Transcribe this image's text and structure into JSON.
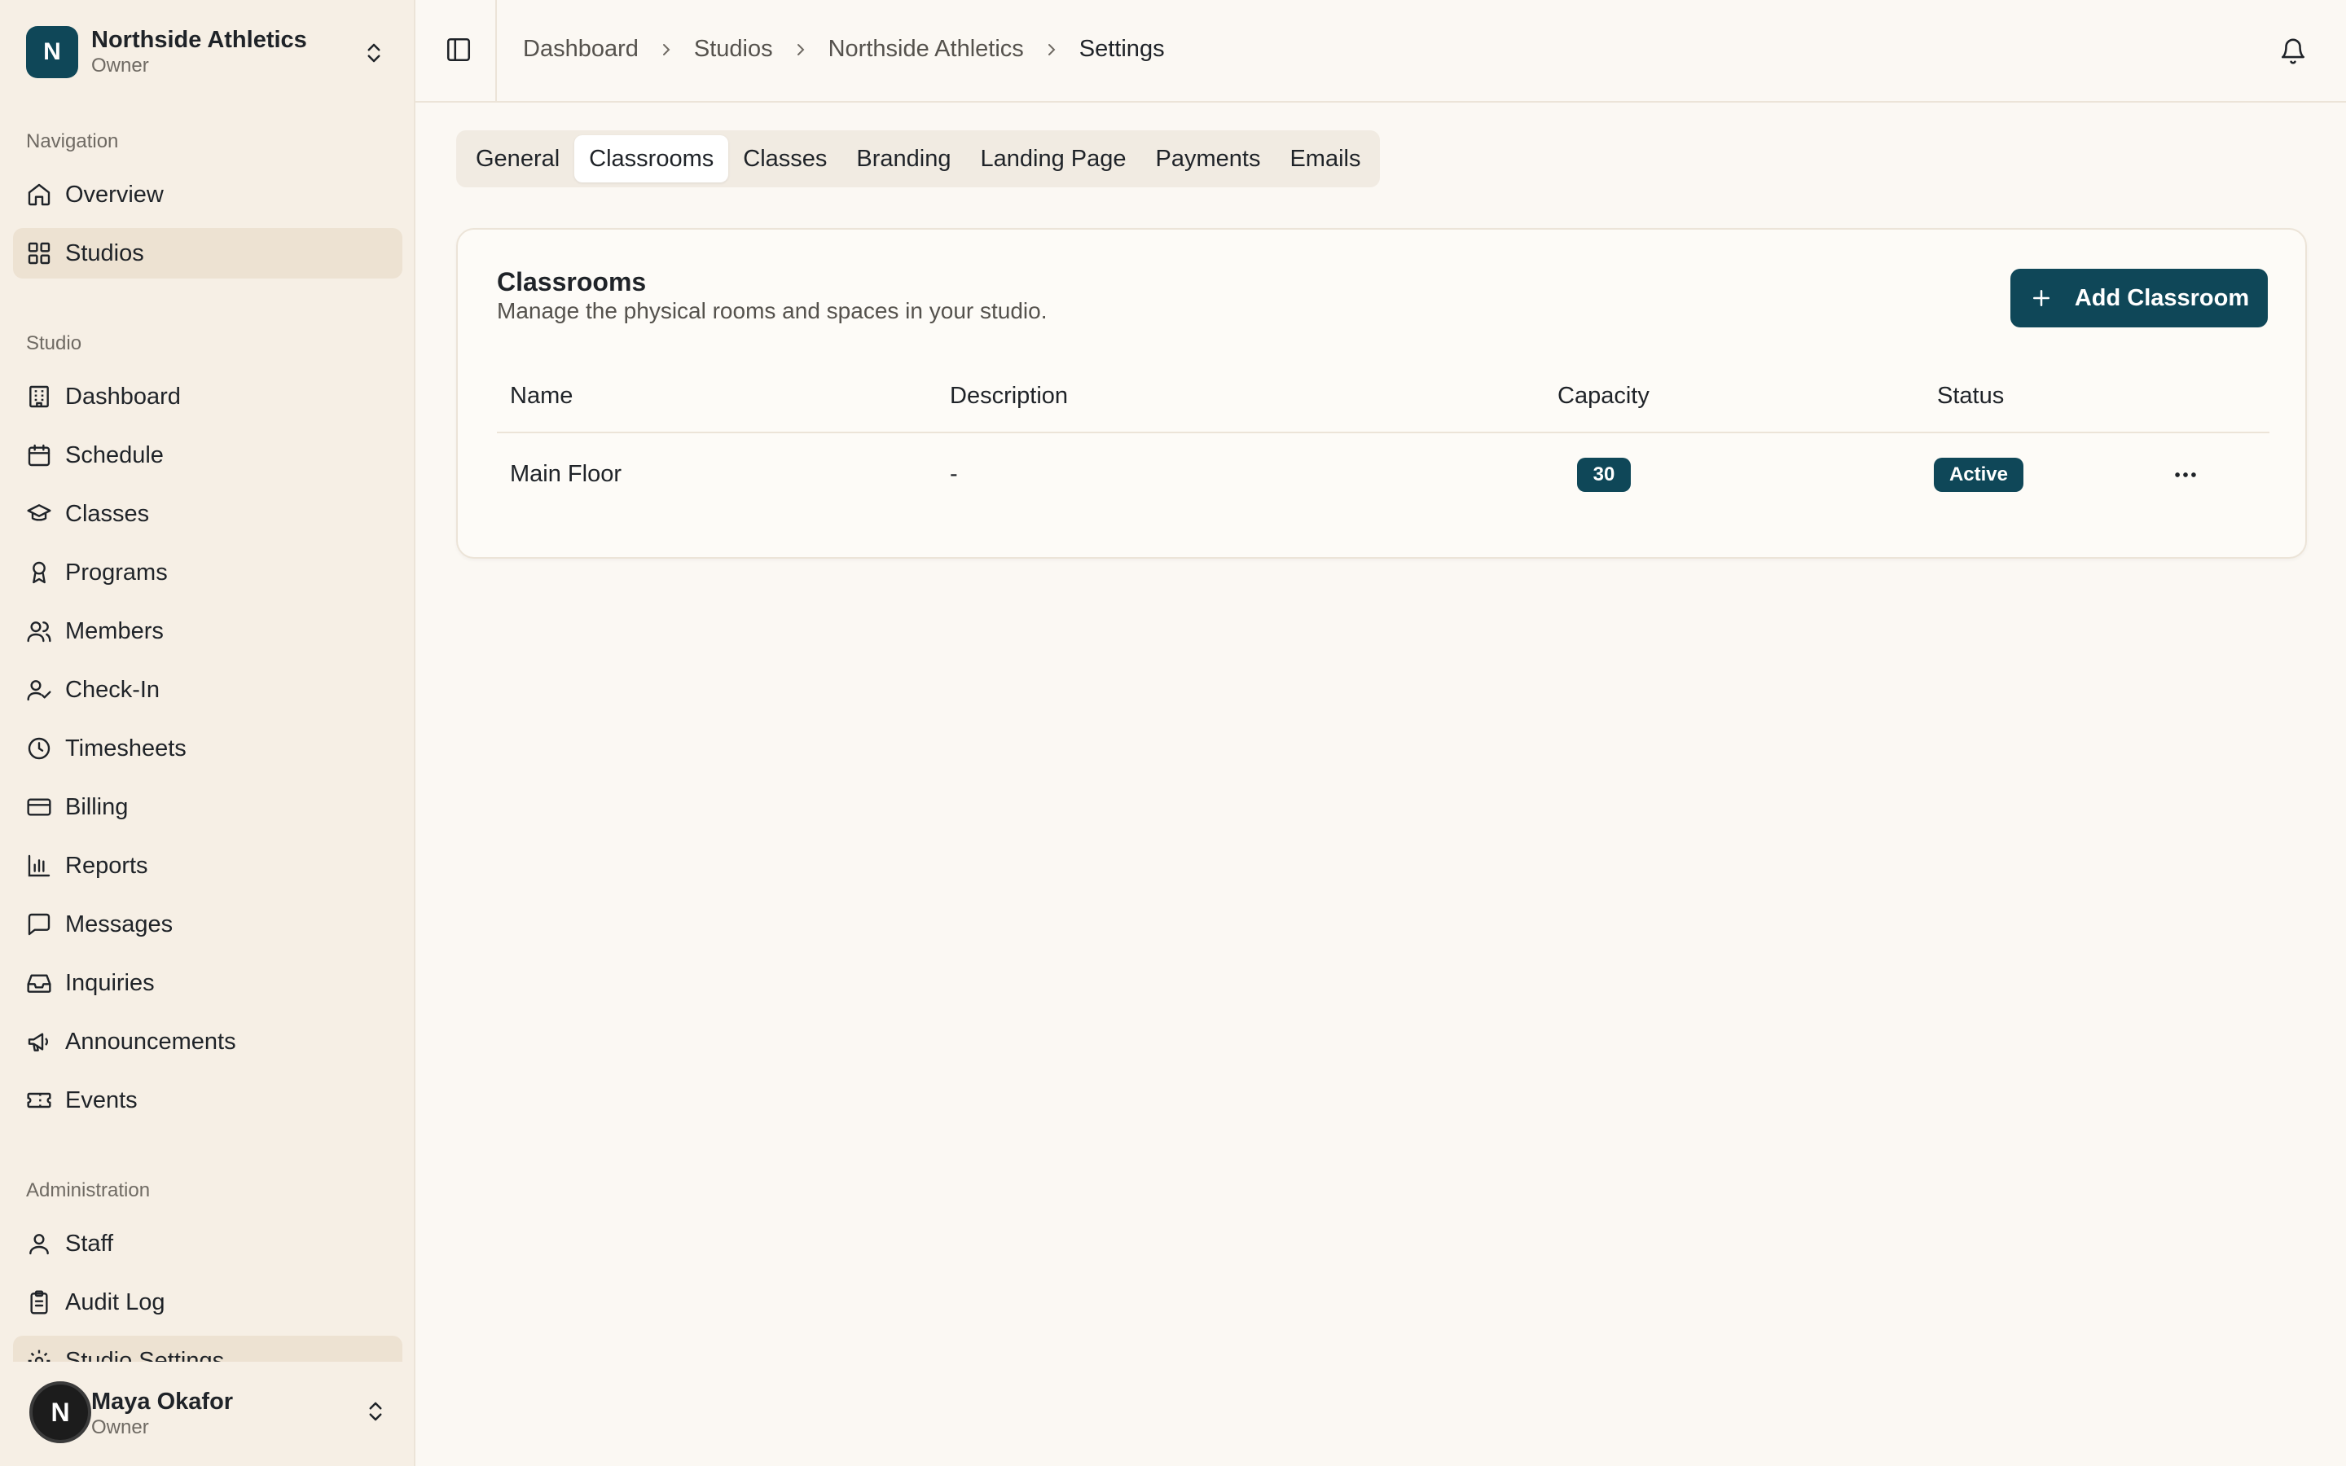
{
  "org": {
    "initial": "N",
    "name": "Northside Athletics",
    "role": "Owner"
  },
  "sidebar": {
    "sections": {
      "navigation": "Navigation",
      "studio": "Studio",
      "administration": "Administration"
    },
    "navigation": [
      {
        "label": "Overview",
        "icon": "home-icon"
      },
      {
        "label": "Studios",
        "icon": "grid-icon",
        "active": true
      }
    ],
    "studio": [
      {
        "label": "Dashboard",
        "icon": "building-icon"
      },
      {
        "label": "Schedule",
        "icon": "calendar-icon"
      },
      {
        "label": "Classes",
        "icon": "graduation-cap-icon"
      },
      {
        "label": "Programs",
        "icon": "award-icon"
      },
      {
        "label": "Members",
        "icon": "users-icon"
      },
      {
        "label": "Check-In",
        "icon": "user-check-icon"
      },
      {
        "label": "Timesheets",
        "icon": "clock-icon"
      },
      {
        "label": "Billing",
        "icon": "credit-card-icon"
      },
      {
        "label": "Reports",
        "icon": "bar-chart-icon"
      },
      {
        "label": "Messages",
        "icon": "message-square-icon"
      },
      {
        "label": "Inquiries",
        "icon": "inbox-icon"
      },
      {
        "label": "Announcements",
        "icon": "megaphone-icon"
      },
      {
        "label": "Events",
        "icon": "ticket-icon"
      }
    ],
    "administration": [
      {
        "label": "Staff",
        "icon": "user-icon"
      },
      {
        "label": "Audit Log",
        "icon": "clipboard-icon"
      },
      {
        "label": "Studio Settings",
        "icon": "settings-icon",
        "active": true
      }
    ]
  },
  "user": {
    "initial": "N",
    "name": "Maya Okafor",
    "role": "Owner"
  },
  "breadcrumb": [
    "Dashboard",
    "Studios",
    "Northside Athletics",
    "Settings"
  ],
  "tabs": [
    "General",
    "Classrooms",
    "Classes",
    "Branding",
    "Landing Page",
    "Payments",
    "Emails"
  ],
  "active_tab": "Classrooms",
  "card": {
    "title": "Classrooms",
    "subtitle": "Manage the physical rooms and spaces in your studio.",
    "add_button": "Add Classroom"
  },
  "table": {
    "columns": [
      "Name",
      "Description",
      "Capacity",
      "Status"
    ],
    "rows": [
      {
        "name": "Main Floor",
        "description": "-",
        "capacity": "30",
        "status": "Active"
      }
    ]
  },
  "colors": {
    "accent": "#0f4758",
    "sidebar_bg": "#f6efe5",
    "page_bg": "#fbf8f3"
  }
}
